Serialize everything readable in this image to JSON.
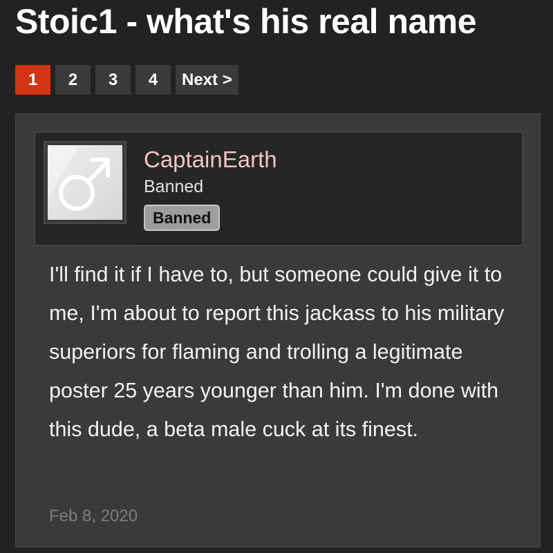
{
  "thread": {
    "title": "Stoic1 - what's his real name"
  },
  "pagination": {
    "pages": [
      "1",
      "2",
      "3",
      "4"
    ],
    "current": "1",
    "next_label": "Next >"
  },
  "post": {
    "author": {
      "username": "CaptainEarth",
      "user_title": "Banned",
      "banner": "Banned",
      "avatar_icon": "male-symbol-icon"
    },
    "body": "I'll find it if I have to, but someone could give it to me, I'm about to report this jackass to his military superiors for flaming and trolling a legitimate poster 25 years younger than him. I'm done with this dude, a beta male cuck at its finest.",
    "date": "Feb 8, 2020"
  },
  "colors": {
    "background": "#222222",
    "active_page": "#d13513",
    "page_button": "#3a3a3a",
    "username": "#f4c6c6",
    "banner_bg": "#9d9d9d"
  }
}
